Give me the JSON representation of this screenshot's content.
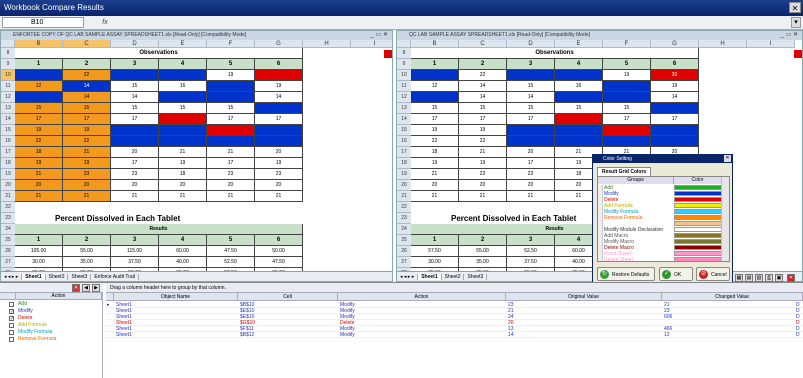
{
  "app": {
    "title": "Workbook Compare Results",
    "close_glyph": "✕"
  },
  "formula_bar": {
    "cell_ref": "B10",
    "fx": "fx"
  },
  "left_pane": {
    "title": "ENFORTEE COPY OF QC LAB SAMPLE ASSAY SPREADSHEET1.xls [Read-Only] [Compatibility Mode]",
    "window_controls": "_ ▭ ✕",
    "columns": [
      "A",
      "B",
      "C",
      "D",
      "E",
      "F",
      "G",
      "H",
      "I"
    ],
    "selected_columns": [
      "B",
      "C"
    ],
    "obs_title": "Observations",
    "obs_headers": [
      "1",
      "2",
      "3",
      "4",
      "5",
      "6"
    ],
    "obs_rows": [
      {
        "row": "10",
        "values": [
          "",
          "22",
          "",
          "",
          "19",
          ""
        ],
        "colors": [
          "#0033cc",
          "#f39a1e",
          "#0033cc",
          "#0033cc",
          "#ffffff",
          "#e00000"
        ]
      },
      {
        "row": "11",
        "values": [
          "12",
          "14",
          "15",
          "16",
          "",
          "19"
        ],
        "colors": [
          "#f39a1e",
          "#0033cc",
          "#ffffff",
          "#ffffff",
          "#0033cc",
          "#ffffff"
        ]
      },
      {
        "row": "12",
        "values": [
          "",
          "14",
          "14",
          "",
          "",
          "14"
        ],
        "colors": [
          "#0033cc",
          "#f39a1e",
          "#ffffff",
          "#0033cc",
          "#0033cc",
          "#ffffff"
        ]
      },
      {
        "row": "13",
        "values": [
          "15",
          "15",
          "15",
          "15",
          "15",
          ""
        ],
        "colors": [
          "#f39a1e",
          "#f39a1e",
          "#ffffff",
          "#ffffff",
          "#ffffff",
          "#0033cc"
        ]
      },
      {
        "row": "14",
        "values": [
          "17",
          "17",
          "17",
          "",
          "17",
          "17"
        ],
        "colors": [
          "#f39a1e",
          "#f39a1e",
          "#ffffff",
          "#e00000",
          "#ffffff",
          "#ffffff"
        ]
      },
      {
        "row": "15",
        "values": [
          "19",
          "19",
          "",
          "",
          "",
          ""
        ],
        "colors": [
          "#f39a1e",
          "#f39a1e",
          "#0033cc",
          "#0033cc",
          "#e00000",
          "#0033cc"
        ]
      },
      {
        "row": "16",
        "values": [
          "22",
          "22",
          "",
          "",
          "",
          ""
        ],
        "colors": [
          "#f39a1e",
          "#f39a1e",
          "#0033cc",
          "#0033cc",
          "#0033cc",
          "#0033cc"
        ]
      },
      {
        "row": "17",
        "values": [
          "18",
          "21",
          "20",
          "21",
          "21",
          "20"
        ],
        "colors": [
          "#f39a1e",
          "#f39a1e",
          "#ffffff",
          "#ffffff",
          "#ffffff",
          "#ffffff"
        ]
      },
      {
        "row": "18",
        "values": [
          "19",
          "19",
          "17",
          "19",
          "17",
          "19"
        ],
        "colors": [
          "#f39a1e",
          "#f39a1e",
          "#ffffff",
          "#ffffff",
          "#ffffff",
          "#ffffff"
        ]
      },
      {
        "row": "19",
        "values": [
          "21",
          "23",
          "23",
          "18",
          "23",
          "23"
        ],
        "colors": [
          "#f39a1e",
          "#f39a1e",
          "#ffffff",
          "#ffffff",
          "#ffffff",
          "#ffffff"
        ]
      },
      {
        "row": "20",
        "values": [
          "20",
          "20",
          "20",
          "20",
          "20",
          "20"
        ],
        "colors": [
          "#f39a1e",
          "#f39a1e",
          "#ffffff",
          "#ffffff",
          "#ffffff",
          "#ffffff"
        ]
      },
      {
        "row": "21",
        "values": [
          "21",
          "21",
          "21",
          "21",
          "21",
          "21"
        ],
        "colors": [
          "#f39a1e",
          "#f39a1e",
          "#ffffff",
          "#ffffff",
          "#ffffff",
          "#ffffff"
        ]
      }
    ],
    "pct_title": "Percent Dissolved in Each Tablet",
    "results_label": "Results",
    "pct_headers": [
      "1",
      "2",
      "3",
      "4",
      "5",
      "6"
    ],
    "pct_rows": [
      {
        "row": "26",
        "values": [
          "105.00",
          "55.00",
          "115.00",
          "60.00",
          "47.50",
          "50.00"
        ]
      },
      {
        "row": "27",
        "values": [
          "30.00",
          "35.00",
          "37.50",
          "40.00",
          "52.50",
          "47.50"
        ]
      },
      {
        "row": "28",
        "values": [
          "35.00",
          "35.00",
          "55.00",
          "35.00",
          "52.50",
          "35.00"
        ]
      },
      {
        "row": "29",
        "values": [
          "37.50",
          "37.50",
          "37.50",
          "37.50",
          "37.50",
          "37.50"
        ]
      },
      {
        "row": "30",
        "values": [
          "42.50",
          "42.50",
          "42.50",
          "45.00",
          "42.50",
          "42.50"
        ]
      },
      {
        "row": "31",
        "values": [
          "47.50",
          "47.50",
          "52.50",
          "47.50",
          "50.00",
          "47.50"
        ]
      },
      {
        "row": "32",
        "values": [
          "55.00",
          "55.00",
          "55.00",
          "55.00",
          "55.00",
          "55.00"
        ]
      }
    ],
    "sheet_tabs": [
      "Sheet1",
      "Sheet2",
      "Sheet3",
      "Enforce Audit Trail"
    ]
  },
  "right_pane": {
    "title": "QC LAB SAMPLE ASSAY SPREADSHEET1.xls [Read-Only] [Compatibility Mode]",
    "window_controls": "_ ▭ ✕",
    "obs_rows": [
      {
        "row": "10",
        "values": [
          "",
          "22",
          "",
          "",
          "19",
          "20"
        ],
        "colors": [
          "#0033cc",
          "#ffffff",
          "#0033cc",
          "#0033cc",
          "#ffffff",
          "#e00000"
        ]
      },
      {
        "row": "11",
        "values": [
          "12",
          "14",
          "15",
          "16",
          "",
          "19"
        ],
        "colors": [
          "#ffffff",
          "#ffffff",
          "#ffffff",
          "#ffffff",
          "#0033cc",
          "#ffffff"
        ]
      },
      {
        "row": "12",
        "values": [
          "",
          "14",
          "14",
          "",
          "",
          "14"
        ],
        "colors": [
          "#0033cc",
          "#ffffff",
          "#ffffff",
          "#0033cc",
          "#0033cc",
          "#ffffff"
        ]
      },
      {
        "row": "13",
        "values": [
          "15",
          "15",
          "15",
          "15",
          "15",
          ""
        ],
        "colors": [
          "#ffffff",
          "#ffffff",
          "#ffffff",
          "#ffffff",
          "#ffffff",
          "#0033cc"
        ]
      },
      {
        "row": "14",
        "values": [
          "17",
          "17",
          "17",
          "",
          "17",
          "17"
        ],
        "colors": [
          "#ffffff",
          "#ffffff",
          "#ffffff",
          "#e00000",
          "#ffffff",
          "#ffffff"
        ]
      },
      {
        "row": "15",
        "values": [
          "19",
          "19",
          "",
          "",
          "",
          ""
        ],
        "colors": [
          "#ffffff",
          "#ffffff",
          "#0033cc",
          "#0033cc",
          "#e00000",
          "#0033cc"
        ]
      },
      {
        "row": "16",
        "values": [
          "22",
          "22",
          "",
          "",
          "",
          ""
        ],
        "colors": [
          "#ffffff",
          "#ffffff",
          "#0033cc",
          "#0033cc",
          "#0033cc",
          "#0033cc"
        ]
      },
      {
        "row": "17",
        "values": [
          "18",
          "21",
          "20",
          "21",
          "21",
          "20"
        ],
        "colors": [
          "#ffffff",
          "#ffffff",
          "#ffffff",
          "#ffffff",
          "#ffffff",
          "#ffffff"
        ]
      },
      {
        "row": "18",
        "values": [
          "19",
          "19",
          "17",
          "19",
          "17",
          "19"
        ],
        "colors": [
          "#ffffff",
          "#ffffff",
          "#ffffff",
          "#ffffff",
          "#ffffff",
          "#ffffff"
        ]
      },
      {
        "row": "19",
        "values": [
          "21",
          "23",
          "23",
          "18",
          "23",
          "23"
        ],
        "colors": [
          "#ffffff",
          "#ffffff",
          "#ffffff",
          "#ffffff",
          "#ffffff",
          "#ffffff"
        ]
      },
      {
        "row": "20",
        "values": [
          "20",
          "20",
          "20",
          "20",
          "20",
          "20"
        ],
        "colors": [
          "#ffffff",
          "#ffffff",
          "#ffffff",
          "#ffffff",
          "#ffffff",
          "#ffffff"
        ]
      },
      {
        "row": "21",
        "values": [
          "21",
          "21",
          "21",
          "21",
          "21",
          "21"
        ],
        "colors": [
          "#ffffff",
          "#ffffff",
          "#ffffff",
          "#ffffff",
          "#ffffff",
          "#ffffff"
        ]
      }
    ],
    "pct_rows": [
      {
        "row": "26",
        "values": [
          "57.50",
          "55.00",
          "52.50",
          "60.00",
          "",
          ""
        ]
      },
      {
        "row": "27",
        "values": [
          "30.00",
          "35.00",
          "37.50",
          "40.00",
          "",
          ""
        ]
      },
      {
        "row": "28",
        "values": [
          "35.00",
          "35.00",
          "55.00",
          "35.00",
          "",
          ""
        ]
      },
      {
        "row": "29",
        "values": [
          "37.50",
          "37.50",
          "37.50",
          "37.50",
          "",
          ""
        ]
      },
      {
        "row": "30",
        "values": [
          "42.50",
          "42.50",
          "42.50",
          "45.00",
          "",
          ""
        ]
      },
      {
        "row": "31",
        "values": [
          "47.50",
          "47.50",
          "52.50",
          "47.50",
          "",
          ""
        ]
      },
      {
        "row": "32",
        "values": [
          "55.00",
          "55.00",
          "55.00",
          "55.00",
          "",
          ""
        ]
      }
    ],
    "sheet_tabs": [
      "Sheet1",
      "Sheet2",
      "Sheet3"
    ]
  },
  "color_dialog": {
    "title": "Color Setting",
    "tab": "Result Grid Colors",
    "col_groups": "Groups",
    "col_color": "Color",
    "items": [
      {
        "name": "Add",
        "text_color": "#2a8a2a",
        "swatch": "#22aa22"
      },
      {
        "name": "Modify",
        "text_color": "#2233bb",
        "swatch": "#0033cc"
      },
      {
        "name": "Delete",
        "text_color": "#cc0000",
        "swatch": "#e00000"
      },
      {
        "name": "Add Formula",
        "text_color": "#b0b000",
        "swatch": "#f0f000"
      },
      {
        "name": "Modify Formula",
        "text_color": "#00a0c0",
        "swatch": "#33ccff"
      },
      {
        "name": "Remove Formula",
        "text_color": "#ee6600",
        "swatch": "#ff8800"
      },
      {
        "name": "",
        "text_color": "#333",
        "swatch": "#f5c28c"
      },
      {
        "name": "Modify Module Declaration",
        "text_color": "#333",
        "swatch": "#ffffff"
      },
      {
        "name": "Add Macro",
        "text_color": "#555",
        "swatch": "#887722"
      },
      {
        "name": "Modify Macro",
        "text_color": "#555",
        "swatch": "#777733"
      },
      {
        "name": "Delete Macro",
        "text_color": "#800000",
        "swatch": "#880000"
      },
      {
        "name": "Insert Sheet",
        "text_color": "#ff99cc",
        "swatch": "#ff99cc"
      },
      {
        "name": "Delete Sheet",
        "text_color": "#ff99cc",
        "swatch": "#ff88bb"
      }
    ],
    "buttons": {
      "restore": "Restore Defaults",
      "ok": "OK",
      "cancel": "Cancel"
    }
  },
  "bottom_panel": {
    "group_hint": "Drag a column header here to group by that column.",
    "action_header": "Action",
    "actions": [
      {
        "label": "Add",
        "color": "#2a8a2a",
        "checked": false
      },
      {
        "label": "Modify",
        "color": "#2233bb",
        "checked": true
      },
      {
        "label": "Delete",
        "color": "#cc0000",
        "checked": true
      },
      {
        "label": "Add Formula",
        "color": "#b0b000",
        "checked": false
      },
      {
        "label": "Modify Formula",
        "color": "#00a0c0",
        "checked": false
      },
      {
        "label": "Remove Formula",
        "color": "#ee6600",
        "checked": false
      }
    ],
    "columns": [
      "Object Name",
      "Cell",
      "Action",
      "Original Value",
      "Changed Value"
    ],
    "rows": [
      {
        "obj": "Sheet1",
        "cell": "$B$10",
        "action": "Modify",
        "orig": "23",
        "changed": "21",
        "color": "#2233bb"
      },
      {
        "obj": "Sheet1",
        "cell": "$E$10",
        "action": "Modify",
        "orig": "21",
        "changed": "23",
        "color": "#2233bb"
      },
      {
        "obj": "Sheet1",
        "cell": "$E$10",
        "action": "Modify",
        "orig": "24",
        "changed": "606",
        "color": "#2233bb"
      },
      {
        "obj": "Sheet1",
        "cell": "$G$10",
        "action": "Delete",
        "orig": "20",
        "changed": "",
        "color": "#cc0000"
      },
      {
        "obj": "Sheet1",
        "cell": "$F$11",
        "action": "Modify",
        "orig": "13",
        "changed": "466",
        "color": "#2233bb"
      },
      {
        "obj": "Sheet1",
        "cell": "$B$12",
        "action": "Modify",
        "orig": "14",
        "changed": "12",
        "color": "#2233bb"
      }
    ]
  }
}
